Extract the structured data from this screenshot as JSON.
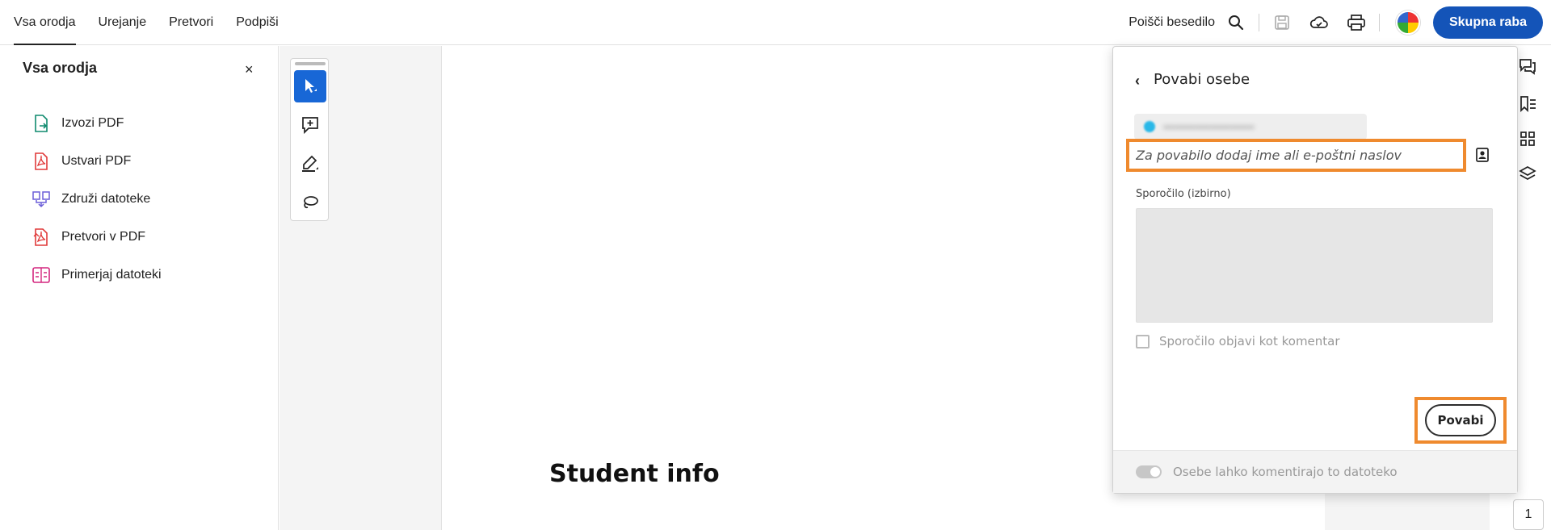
{
  "nav": {
    "tabs": [
      {
        "label": "Vsa orodja",
        "active": true
      },
      {
        "label": "Urejanje"
      },
      {
        "label": "Pretvori"
      },
      {
        "label": "Podpiši"
      }
    ]
  },
  "header": {
    "find_label": "Poišči besedilo",
    "share_label": "Skupna raba",
    "icons": [
      "search-icon",
      "save-icon",
      "cloud-sync-icon",
      "print-icon",
      "avatar"
    ]
  },
  "left_panel": {
    "title": "Vsa orodja",
    "close_glyph": "×",
    "items": [
      {
        "label": "Izvozi PDF",
        "icon": "export-pdf-icon",
        "color": "#0e8a6e"
      },
      {
        "label": "Ustvari PDF",
        "icon": "create-pdf-icon",
        "color": "#e03a3a"
      },
      {
        "label": "Združi datoteke",
        "icon": "combine-files-icon",
        "color": "#6b5fd8"
      },
      {
        "label": "Pretvori v PDF",
        "icon": "convert-pdf-icon",
        "color": "#e03a3a"
      },
      {
        "label": "Primerjaj datoteki",
        "icon": "compare-files-icon",
        "color": "#d4267e"
      }
    ]
  },
  "toolbar": {
    "tools": [
      "select-tool-icon",
      "add-comment-icon",
      "highlight-tool-icon",
      "draw-lasso-icon"
    ]
  },
  "document": {
    "heading": "Student info"
  },
  "share_popup": {
    "back_glyph": "‹",
    "title": "Povabi osebe",
    "invite_placeholder": "Za povabilo dodaj ime ali e-poštni naslov",
    "message_label": "Sporočilo (izbirno)",
    "checkbox_label": "Sporočilo objavi kot komentar",
    "invite_button": "Povabi",
    "footer_toggle_label": "Osebe lahko komentirajo to datoteko"
  },
  "right_rail": {
    "icons": [
      "comments-icon",
      "bookmarks-icon",
      "thumbnails-icon",
      "layers-icon"
    ],
    "page_number": "1"
  },
  "colors": {
    "accent": "#1454b8",
    "highlight": "#ef8a2e",
    "active_tool": "#1867d6"
  }
}
